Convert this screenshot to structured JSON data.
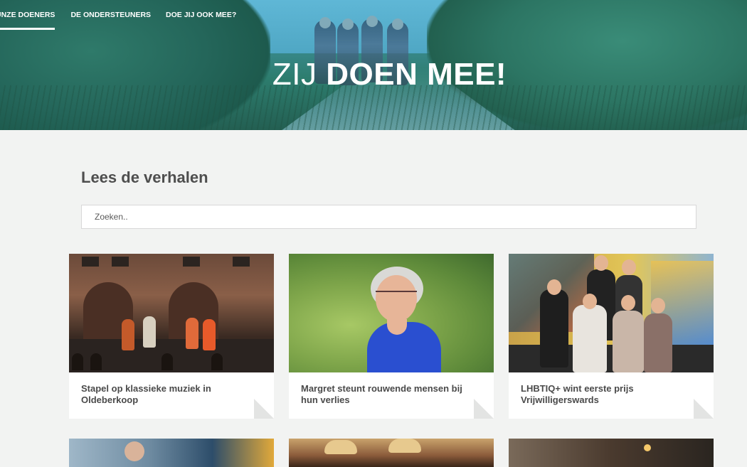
{
  "nav": {
    "items": [
      {
        "label": "UNZE DOENERS",
        "active": true
      },
      {
        "label": "DE ONDERSTEUNERS",
        "active": false
      },
      {
        "label": "DOE JIJ OOK MEE?",
        "active": false
      }
    ]
  },
  "hero": {
    "title_light": "ZIJ",
    "title_bold": "DOEN MEE!"
  },
  "stories": {
    "heading": "Lees de verhalen",
    "search_placeholder": "Zoeken..",
    "cards": [
      {
        "title": "Stapel op klassieke muziek in Oldeberkoop",
        "image": "concert-photo"
      },
      {
        "title": "Margret steunt rouwende mensen bij hun verlies",
        "image": "woman-portrait-photo"
      },
      {
        "title": "LHBTIQ+ wint eerste prijs Vrijwilligerswards",
        "image": "group-photo"
      }
    ],
    "more_cards": [
      {
        "image": "man-photo"
      },
      {
        "image": "cafe-lamps-photo"
      },
      {
        "image": "interior-photo"
      }
    ]
  },
  "colors": {
    "background": "#f2f3f2",
    "text_dark": "#4e4e4e",
    "nav_text": "#ffffff",
    "card_fold": "#e3e4e3"
  }
}
